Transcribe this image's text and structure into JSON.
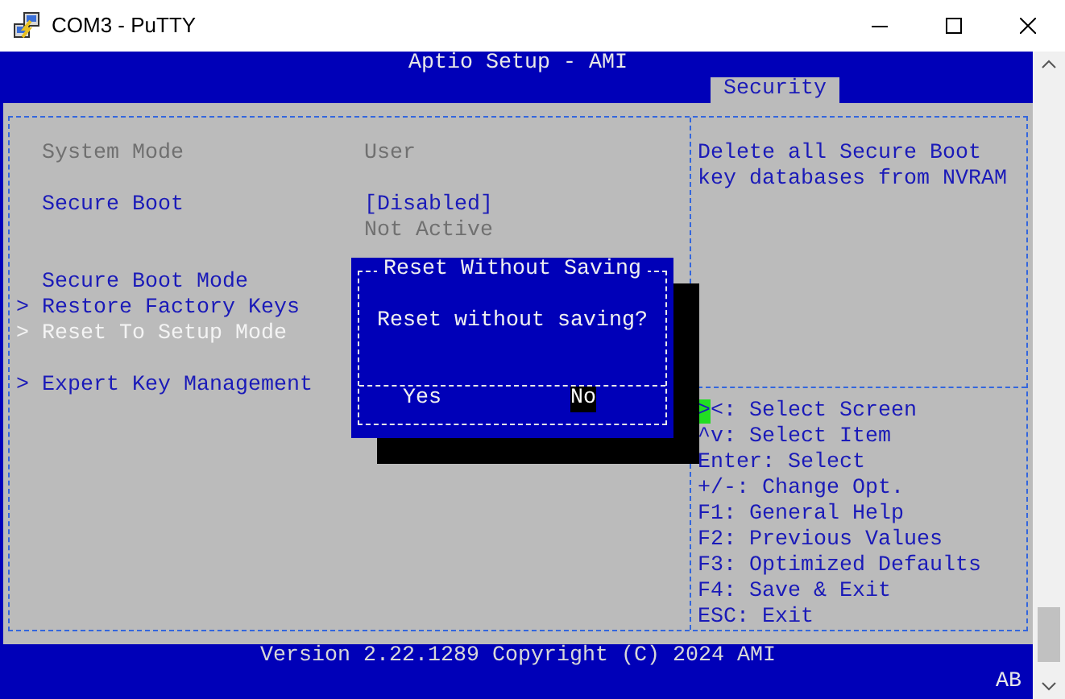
{
  "window": {
    "title": "COM3 - PuTTY"
  },
  "header": {
    "title": "Aptio Setup - AMI",
    "tabs": [
      {
        "label": "Security",
        "selected": true
      }
    ]
  },
  "settings": [
    {
      "kind": "info",
      "label": "System Mode",
      "value": "User"
    },
    {
      "kind": "blank"
    },
    {
      "kind": "option",
      "label": "Secure Boot",
      "value": "[Disabled]",
      "selected": false
    },
    {
      "kind": "status",
      "value": "Not Active"
    },
    {
      "kind": "blank"
    },
    {
      "kind": "option",
      "label": "Secure Boot Mode",
      "selected": false
    },
    {
      "kind": "submenu",
      "marker": ">",
      "label": "Restore Factory Keys",
      "selected": false
    },
    {
      "kind": "submenu",
      "marker": ">",
      "label": "Reset To Setup Mode",
      "selected": true
    },
    {
      "kind": "blank"
    },
    {
      "kind": "submenu",
      "marker": ">",
      "label": "Expert Key Management",
      "selected": false
    }
  ],
  "help_text": [
    "Delete all Secure Boot",
    "key databases from NVRAM"
  ],
  "key_help": [
    {
      "text": "><: Select Screen",
      "cursor": true
    },
    {
      "text": "^v: Select Item",
      "cursor": false
    },
    {
      "text": "Enter: Select",
      "cursor": false
    },
    {
      "text": "+/-: Change Opt.",
      "cursor": false
    },
    {
      "text": "F1: General Help",
      "cursor": false
    },
    {
      "text": "F2: Previous Values",
      "cursor": false
    },
    {
      "text": "F3: Optimized Defaults",
      "cursor": false
    },
    {
      "text": "F4: Save & Exit",
      "cursor": false
    },
    {
      "text": "ESC: Exit",
      "cursor": false
    }
  ],
  "dialog": {
    "title": "Reset Without Saving",
    "message": "Reset without saving?",
    "buttons": [
      {
        "label": "Yes",
        "selected": false
      },
      {
        "label": "No",
        "selected": true
      }
    ]
  },
  "footer": {
    "version": "Version 2.22.1289 Copyright (C) 2024 AMI",
    "indicator": "AB"
  }
}
